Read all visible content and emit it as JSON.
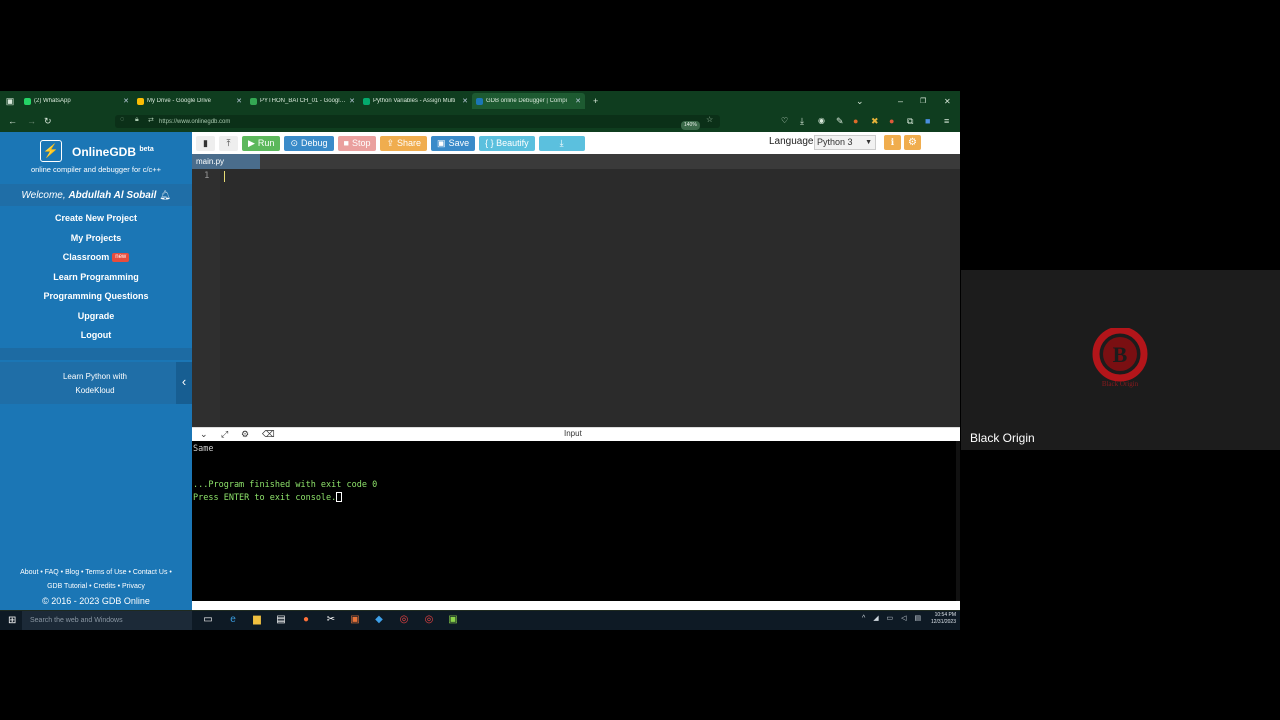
{
  "browser": {
    "tabs": [
      {
        "label": "(2) WhatsApp",
        "icon": "whatsapp-icon",
        "color": "#25d366",
        "active": false
      },
      {
        "label": "My Drive - Google Drive",
        "icon": "drive-icon",
        "color": "#fbbc04",
        "active": false
      },
      {
        "label": "PYTHON_BATCH_01 - Google S",
        "icon": "sheets-icon",
        "color": "#34a853",
        "active": false
      },
      {
        "label": "Python Variables - Assign Multi",
        "icon": "w3schools-icon",
        "color": "#04aa6d",
        "active": false
      },
      {
        "label": "GDB online Debugger | Compi",
        "icon": "gdb-icon",
        "color": "#1b76b5",
        "active": true
      }
    ],
    "url": "https://www.onlinegdb.com",
    "zoom": "140%"
  },
  "site": {
    "logo_title": "OnlineGDB",
    "logo_beta": "beta",
    "logo_sub": "online compiler and debugger for c/c++",
    "welcome_prefix": "Welcome, ",
    "welcome_user": "Abdullah Al Sobail",
    "menu": [
      {
        "label": "Create New Project"
      },
      {
        "label": "My Projects"
      },
      {
        "label": "Classroom",
        "badge": "new"
      },
      {
        "label": "Learn Programming"
      },
      {
        "label": "Programming Questions"
      },
      {
        "label": "Upgrade"
      },
      {
        "label": "Logout"
      }
    ],
    "promo_line1": "Learn Python with",
    "promo_line2": "KodeKloud",
    "footer_line1": "About • FAQ • Blog • Terms of Use • Contact Us •",
    "footer_line2": "GDB Tutorial • Credits • Privacy",
    "footer_line3": "© 2016 - 2023 GDB Online"
  },
  "toolbar": {
    "run": "Run",
    "debug": "Debug",
    "stop": "Stop",
    "share": "Share",
    "save": "Save",
    "beautify": "{ } Beautify",
    "language_label": "Language",
    "language_value": "Python 3"
  },
  "editor": {
    "file_tab": "main.py",
    "line_number": "1"
  },
  "console": {
    "input_label": "Input",
    "lines": [
      "Same",
      "...Program finished with exit code 0",
      "Press ENTER to exit console."
    ]
  },
  "taskbar": {
    "search_placeholder": "Search the web and Windows",
    "time": "10:54 PM",
    "date": "12/31/2023"
  },
  "participant": {
    "name": "Black Origin"
  }
}
